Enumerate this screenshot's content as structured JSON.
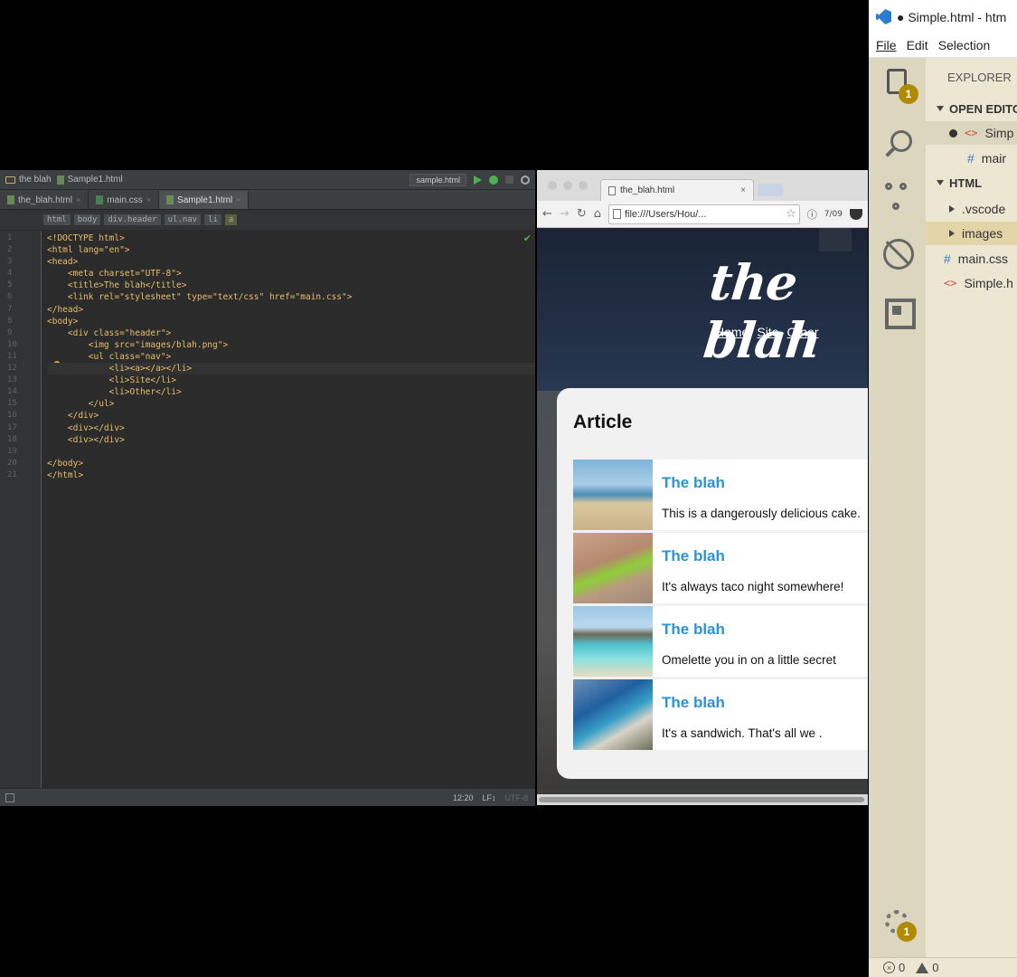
{
  "ide": {
    "project": "the blah",
    "file": "Sample1.html",
    "run_config": "sample.html",
    "tabs": [
      {
        "label": "the_blah.html"
      },
      {
        "label": "main.css"
      },
      {
        "label": "Sample1.html"
      }
    ],
    "crumbs": [
      "html",
      "body",
      "div.header",
      "ul.nav",
      "li",
      "a"
    ],
    "lines": [
      "<!DOCTYPE html>",
      "<html lang=\"en\">",
      "<head>",
      "    <meta charset=\"UTF-8\">",
      "    <title>The blah</title>",
      "    <link rel=\"stylesheet\" type=\"text/css\" href=\"main.css\">",
      "</head>",
      "<body>",
      "    <div class=\"header\">",
      "        <img src=\"images/blah.png\">",
      "        <ul class=\"nav\">",
      "            <li><a></a></li>",
      "            <li>Site</li>",
      "            <li>Other</li>",
      "        </ul>",
      "    </div>",
      "    <div></div>",
      "    <div></div>",
      "",
      "</body>",
      "</html>"
    ],
    "line_numbers": [
      "1",
      "2",
      "3",
      "4",
      "5",
      "6",
      "7",
      "8",
      "9",
      "10",
      "11",
      "12",
      "13",
      "14",
      "15",
      "16",
      "17",
      "18",
      "19",
      "20",
      "21"
    ],
    "status": {
      "position": "12:20",
      "line_sep": "LF↕",
      "encoding": "UTF-8"
    }
  },
  "browser": {
    "tab_title": "the_blah.html",
    "url": "file:///Users/Hou/...",
    "ext_badge": "7/09",
    "logo": "the blah",
    "nav": [
      "Home",
      "Site",
      "Other"
    ],
    "article_heading": "Article",
    "items": [
      {
        "title": "The blah",
        "desc": "This is a dangerously delicious cake."
      },
      {
        "title": "The blah",
        "desc": "It's always taco night somewhere!"
      },
      {
        "title": "The blah",
        "desc": "Omelette you in on a little secret"
      },
      {
        "title": "The blah",
        "desc": "It's a sandwich. That's all we ."
      }
    ]
  },
  "vscode": {
    "title": "● Simple.html - htm",
    "menu": [
      "File",
      "Edit",
      "Selection"
    ],
    "explorer_title": "EXPLORER",
    "files_badge": "1",
    "settings_badge": "1",
    "open_editors_label": "OPEN EDITO",
    "open_editors": [
      {
        "label": "Simp"
      },
      {
        "label": "mair"
      }
    ],
    "folder_label": "HTML",
    "tree": [
      {
        "label": ".vscode"
      },
      {
        "label": "images"
      },
      {
        "label": "main.css"
      },
      {
        "label": "Simple.h"
      }
    ],
    "errors": "0",
    "warnings": "0"
  }
}
